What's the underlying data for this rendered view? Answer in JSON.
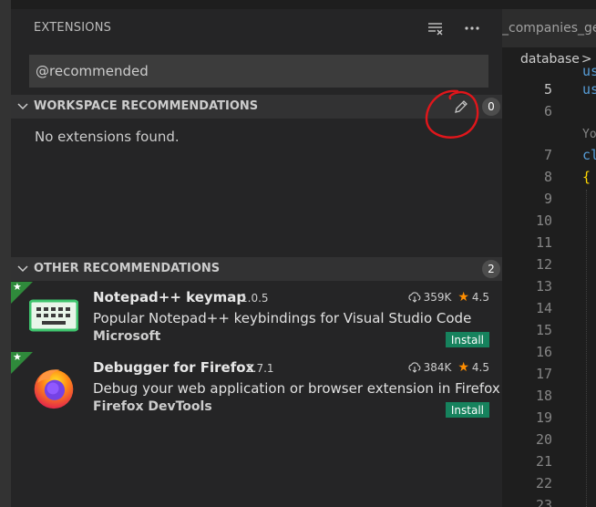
{
  "sidebar": {
    "title": "EXTENSIONS",
    "icons": {
      "clear": "clear-filter-icon",
      "more": "more-actions-icon"
    },
    "search": {
      "value": "@recommended"
    },
    "workspace": {
      "title": "WORKSPACE RECOMMENDATIONS",
      "count": "0",
      "empty_text": "No extensions found.",
      "edit_icon": "pencil-icon"
    },
    "other": {
      "title": "OTHER RECOMMENDATIONS",
      "count": "2",
      "items": [
        {
          "name": "Notepad++ keymap",
          "version": "1.0.5",
          "description": "Popular Notepad++ keybindings for Visual Studio Code",
          "publisher": "Microsoft",
          "downloads": "359K",
          "rating": "4.5",
          "install_label": "Install",
          "icon": "keyboard-icon",
          "corner": "★"
        },
        {
          "name": "Debugger for Firefox",
          "version": "2.7.1",
          "description": "Debug your web application or browser extension in Firefox",
          "publisher": "Firefox DevTools",
          "downloads": "384K",
          "rating": "4.5",
          "install_label": "Install",
          "icon": "firefox-icon",
          "corner": "★"
        }
      ]
    }
  },
  "editor": {
    "tab_label": "_companies_ge",
    "breadcrumb": "database",
    "breadcrumb_sep": ">",
    "lines": [
      {
        "n": "",
        "code": "us",
        "color": "#569cd6"
      },
      {
        "n": "5",
        "code": "us",
        "color": "#569cd6"
      },
      {
        "n": "6",
        "code": "",
        "color": "#d4d4d4"
      },
      {
        "n": "",
        "code": "Yo",
        "color": "#858585"
      },
      {
        "n": "7",
        "code": "cl",
        "color": "#569cd6"
      },
      {
        "n": "8",
        "code": "{",
        "color": "#ffd700"
      },
      {
        "n": "9",
        "code": "",
        "color": "#d4d4d4"
      },
      {
        "n": "10",
        "code": "",
        "color": "#d4d4d4"
      },
      {
        "n": "11",
        "code": "",
        "color": "#d4d4d4"
      },
      {
        "n": "12",
        "code": "",
        "color": "#d4d4d4"
      },
      {
        "n": "13",
        "code": "",
        "color": "#d4d4d4"
      },
      {
        "n": "14",
        "code": "",
        "color": "#d4d4d4"
      },
      {
        "n": "15",
        "code": "",
        "color": "#d4d4d4"
      },
      {
        "n": "16",
        "code": "",
        "color": "#d4d4d4"
      },
      {
        "n": "17",
        "code": "",
        "color": "#d4d4d4"
      },
      {
        "n": "18",
        "code": "",
        "color": "#d4d4d4"
      },
      {
        "n": "19",
        "code": "",
        "color": "#d4d4d4"
      },
      {
        "n": "20",
        "code": "",
        "color": "#d4d4d4"
      },
      {
        "n": "21",
        "code": "",
        "color": "#d4d4d4"
      },
      {
        "n": "22",
        "code": "",
        "color": "#d4d4d4"
      },
      {
        "n": "23",
        "code": "",
        "color": "#d4d4d4"
      }
    ]
  },
  "colors": {
    "install": "#16825d",
    "recommended_corner": "#2f8a3b",
    "annotation": "#e0161b",
    "star": "#ff8e00"
  }
}
